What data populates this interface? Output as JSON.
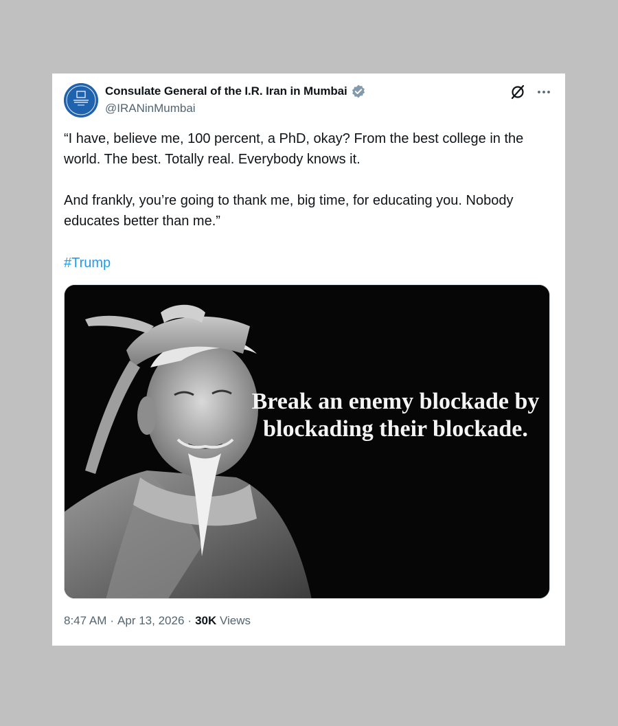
{
  "account": {
    "display_name": "Consulate General of the I.R. Iran in Mumbai",
    "handle": "@IRANinMumbai",
    "verified": true,
    "verified_color": "#829aab"
  },
  "actions": {
    "grok_icon": "grok-icon",
    "more_icon": "more-icon"
  },
  "tweet": {
    "text": "“I have, believe me, 100 percent, a PhD, okay? From the best college in the world. The best. Totally real. Everybody knows it.\n\nAnd frankly, you’re going to thank me, big time, for educating you. Nobody educates better than me.”",
    "hashtag": "#Trump",
    "hashtag_color": "#1d9bf0"
  },
  "media": {
    "quote": "Break an enemy blockade by blockading their blockade."
  },
  "meta": {
    "time": "8:47 AM",
    "separator": "·",
    "date": "Apr 13, 2026",
    "views_count": "30K",
    "views_label": "Views"
  }
}
